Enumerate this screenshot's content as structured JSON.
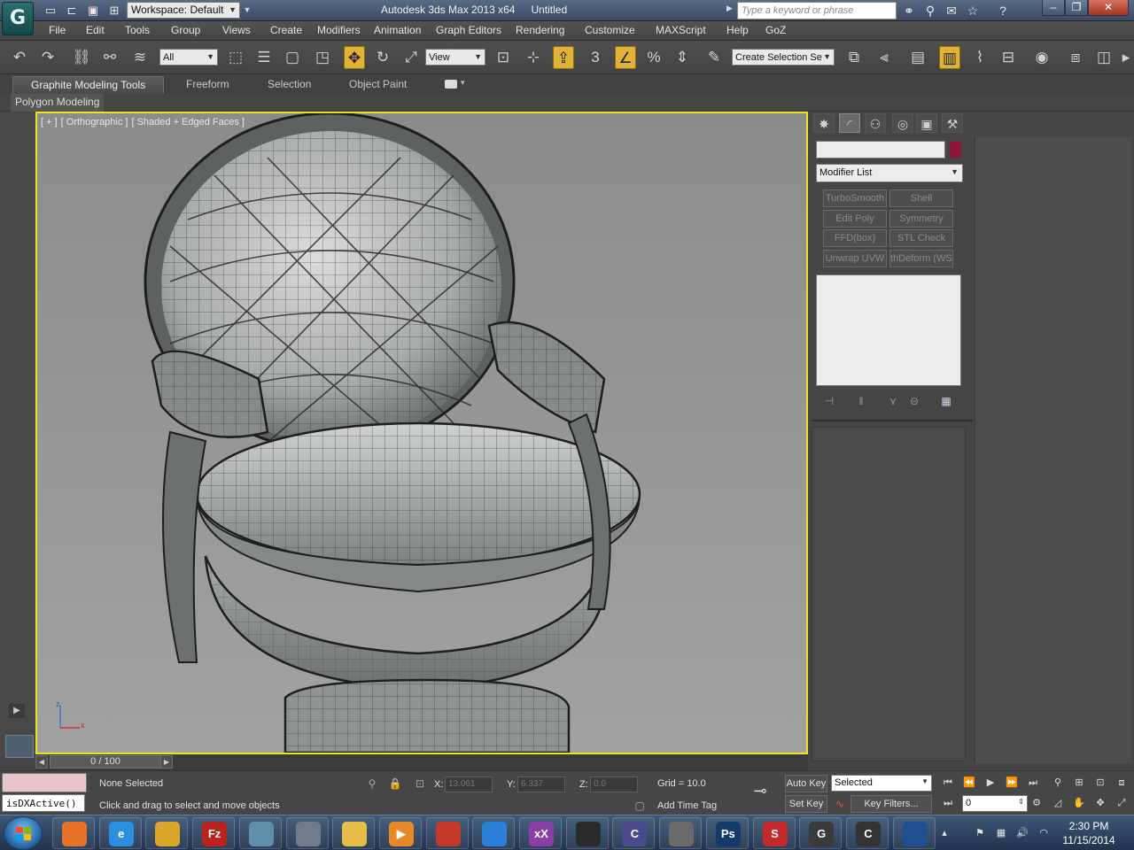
{
  "titlebar": {
    "workspace": "Workspace: Default",
    "app_title": "Autodesk 3ds Max  2013 x64",
    "doc_title": "Untitled",
    "search_placeholder": "Type a keyword or phrase",
    "logo_glyph": "G"
  },
  "menu": [
    "File",
    "Edit",
    "Tools",
    "Group",
    "Views",
    "Create",
    "Modifiers",
    "Animation",
    "Graph Editors",
    "Rendering",
    "Customize",
    "MAXScript",
    "Help",
    "GoZ"
  ],
  "toolbar": {
    "selection_filter": "All",
    "ref_coord": "View",
    "named_selection": "Create Selection Se",
    "snap_label": "3"
  },
  "ribbon": {
    "tabs": [
      "Graphite Modeling Tools",
      "Freeform",
      "Selection",
      "Object Paint"
    ],
    "panel": "Polygon Modeling"
  },
  "viewport": {
    "labels": [
      "[ + ]",
      "[ Orthographic ]",
      "[ Shaded + Edged Faces ]"
    ],
    "axis_x": "x",
    "axis_z": "z"
  },
  "command_panel": {
    "object_color": "#8e1537",
    "modifier_list": "Modifier List",
    "modifier_buttons": [
      "TurboSmooth",
      "Shell",
      "Edit Poly",
      "Symmetry",
      "FFD(box)",
      "STL Check",
      "Unwrap UVW",
      "thDeform (WSM)"
    ]
  },
  "timeline": {
    "frame": "0 / 100"
  },
  "status": {
    "maxscript": "isDXActive()",
    "selection": "None Selected",
    "prompt": "Click and drag to select and move objects",
    "x_label": "X:",
    "x_value": "13.061",
    "y_label": "Y:",
    "y_value": "6.337",
    "z_label": "Z:",
    "z_value": "0.0",
    "grid": "Grid = 10.0",
    "add_time_tag": "Add Time Tag",
    "auto_key": "Auto Key",
    "set_key": "Set Key",
    "key_mode": "Selected",
    "key_filters": "Key Filters...",
    "current_frame": "0"
  },
  "taskbar": {
    "apps": [
      {
        "name": "firefox",
        "color": "#e8712a",
        "label": ""
      },
      {
        "name": "internet-explorer",
        "color": "#2b8fe0",
        "label": "e"
      },
      {
        "name": "chrome",
        "color": "#d9a62a",
        "label": ""
      },
      {
        "name": "filezilla",
        "color": "#b8241c",
        "label": "Fz"
      },
      {
        "name": "app-swirl",
        "color": "#5f8fa9",
        "label": ""
      },
      {
        "name": "app-skull",
        "color": "#6f7b8a",
        "label": ""
      },
      {
        "name": "windows-explorer",
        "color": "#e5be4a",
        "label": ""
      },
      {
        "name": "media-player",
        "color": "#e58a26",
        "label": "▶"
      },
      {
        "name": "filezilla-red",
        "color": "#c33a2a",
        "label": ""
      },
      {
        "name": "dropbox",
        "color": "#2a7fd6",
        "label": ""
      },
      {
        "name": "app-purple",
        "color": "#8a3fa5",
        "label": "xX"
      },
      {
        "name": "app-face",
        "color": "#2a2a2a",
        "label": ""
      },
      {
        "name": "app-c-box",
        "color": "#4a4a8a",
        "label": "C"
      },
      {
        "name": "zbrush",
        "color": "#6a6a6a",
        "label": ""
      },
      {
        "name": "photoshop",
        "color": "#133a6b",
        "label": "Ps"
      },
      {
        "name": "substance",
        "color": "#c42a2a",
        "label": "S"
      },
      {
        "name": "3dsmax",
        "color": "#3a3a3a",
        "label": "G"
      },
      {
        "name": "app-c-ring",
        "color": "#333",
        "label": "C"
      },
      {
        "name": "app-globe",
        "color": "#1f4f8f",
        "label": ""
      }
    ],
    "time": "2:30 PM",
    "date": "11/15/2014"
  }
}
